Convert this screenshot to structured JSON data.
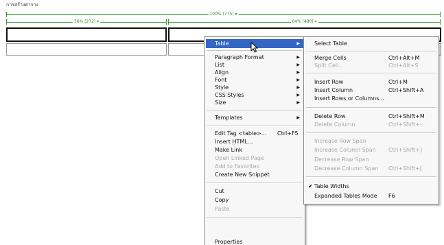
{
  "document": {
    "title": "การสร้างตาราง"
  },
  "guides": {
    "table_width_label": "100% (775) ▾",
    "col1_width_label": "36% (272) ▾",
    "col2_width_label": "64% (490) ▾"
  },
  "context_menu": {
    "items": [
      {
        "label": "Table",
        "arrow": "▶"
      },
      {
        "label": "Paragraph Format",
        "arrow": "▶"
      },
      {
        "label": "List",
        "arrow": "▶"
      },
      {
        "label": "Align",
        "arrow": "▶"
      },
      {
        "label": "Font",
        "arrow": "▶"
      },
      {
        "label": "Style",
        "arrow": "▶"
      },
      {
        "label": "CSS Styles",
        "arrow": "▶"
      },
      {
        "label": "Size",
        "arrow": "▶"
      },
      {
        "label": "Templates",
        "arrow": "▶"
      },
      {
        "label": "Edit Tag <table>...",
        "shortcut": "Ctrl+F5"
      },
      {
        "label": "Insert HTML..."
      },
      {
        "label": "Make Link"
      },
      {
        "label": "Open Linked Page"
      },
      {
        "label": "Add to Favorites"
      },
      {
        "label": "Create New Snippet"
      },
      {
        "label": "Cut"
      },
      {
        "label": "Copy"
      },
      {
        "label": "Paste"
      },
      {
        "label": "Properties"
      }
    ]
  },
  "table_submenu": {
    "items": [
      {
        "label": "Select Table"
      },
      {
        "label": "Merge Cells",
        "shortcut": "Ctrl+Alt+M"
      },
      {
        "label": "Split Cell...",
        "shortcut": "Ctrl+Alt+S"
      },
      {
        "label": "Insert Row",
        "shortcut": "Ctrl+M"
      },
      {
        "label": "Insert Column",
        "shortcut": "Ctrl+Shift+A"
      },
      {
        "label": "Insert Rows or Columns..."
      },
      {
        "label": "Delete Row",
        "shortcut": "Ctrl+Shift+M"
      },
      {
        "label": "Delete Column",
        "shortcut": "Ctrl+Shift+-"
      },
      {
        "label": "Increase Row Span"
      },
      {
        "label": "Increase Column Span",
        "shortcut": "Ctrl+Shift+]"
      },
      {
        "label": "Decrease Row Span"
      },
      {
        "label": "Decrease Column Span",
        "shortcut": "Ctrl+Shift+["
      },
      {
        "label": "Table Widths",
        "check": "✔"
      },
      {
        "label": "Expanded Tables Mode",
        "shortcut": "F6"
      }
    ]
  }
}
